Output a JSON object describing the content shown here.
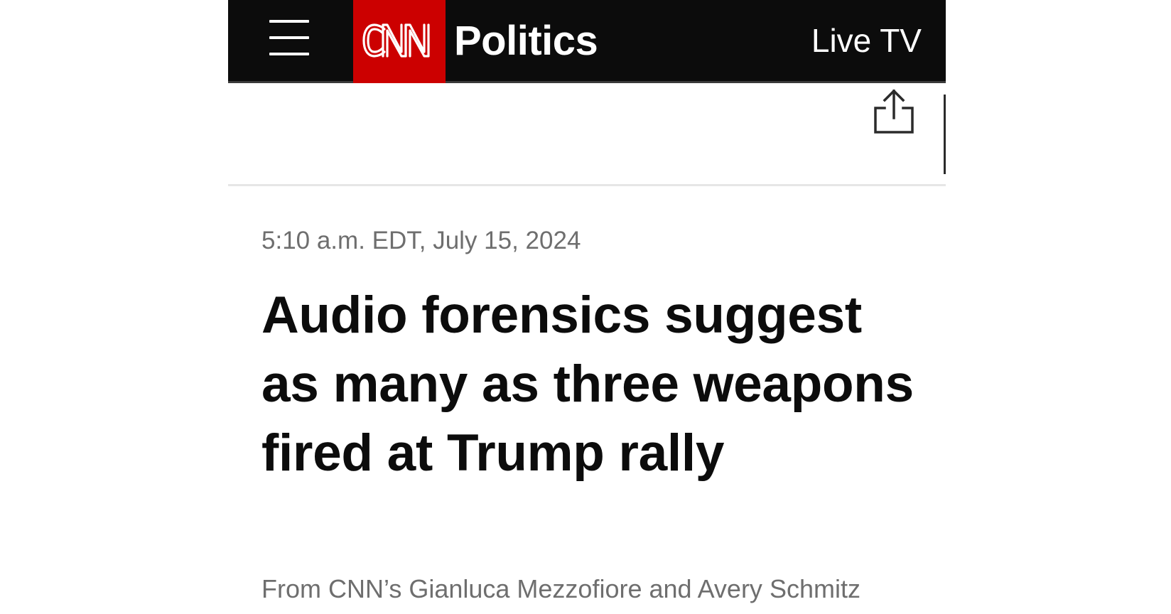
{
  "header": {
    "logo_text": "CNN",
    "section_title": "Politics",
    "live_tv_label": "Live TV",
    "colors": {
      "bar": "#0c0c0c",
      "logo_red": "#cc0000",
      "text": "#ffffff"
    },
    "icons": {
      "menu": "hamburger-menu-icon",
      "share": "share-icon"
    }
  },
  "article": {
    "timestamp": "5:10 a.m. EDT, July 15, 2024",
    "headline": "Audio forensics suggest as many as three weapons fired at Trump rally",
    "byline": "From CNN’s Gianluca Mezzofiore and Avery Schmitz"
  }
}
